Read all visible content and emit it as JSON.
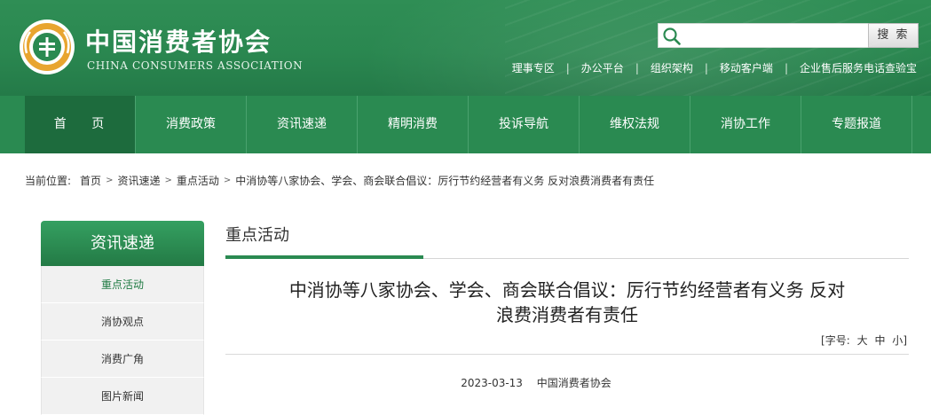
{
  "header": {
    "logo_text": "3·15",
    "site_name": "中国消费者协会",
    "site_name_en": "CHINA CONSUMERS ASSOCIATION",
    "search": {
      "value": "",
      "placeholder": "",
      "button_label": "搜 索"
    },
    "top_links": [
      "理事专区",
      "办公平台",
      "组织架构",
      "移动客户端",
      "企业售后服务电话查验宝"
    ]
  },
  "nav": {
    "items": [
      "首 页",
      "消费政策",
      "资讯速递",
      "精明消费",
      "投诉导航",
      "维权法规",
      "消协工作",
      "专题报道"
    ],
    "active_index": 0
  },
  "breadcrumb": {
    "label": "当前位置:",
    "items": [
      "首页",
      "资讯速递",
      "重点活动",
      "中消协等八家协会、学会、商会联合倡议：厉行节约经营者有义务 反对浪费消费者有责任"
    ],
    "separator": ">"
  },
  "sidebar": {
    "title": "资讯速递",
    "items": [
      "重点活动",
      "消协观点",
      "消费广角",
      "图片新闻"
    ],
    "active_index": 0
  },
  "main": {
    "section_title": "重点活动",
    "article_title_line1": "中消协等八家协会、学会、商会联合倡议：厉行节约经营者有义务 反对",
    "article_title_line2": "浪费消费者有责任",
    "font_size_label": "[字号:",
    "font_size_options": [
      "大",
      "中",
      "小"
    ],
    "font_size_close": "]",
    "date": "2023-03-13",
    "source": "中国消费者协会"
  },
  "colors": {
    "brand_green": "#2a8a51",
    "nav_active": "#1d6b3d",
    "logo_gold": "#e8a530"
  }
}
